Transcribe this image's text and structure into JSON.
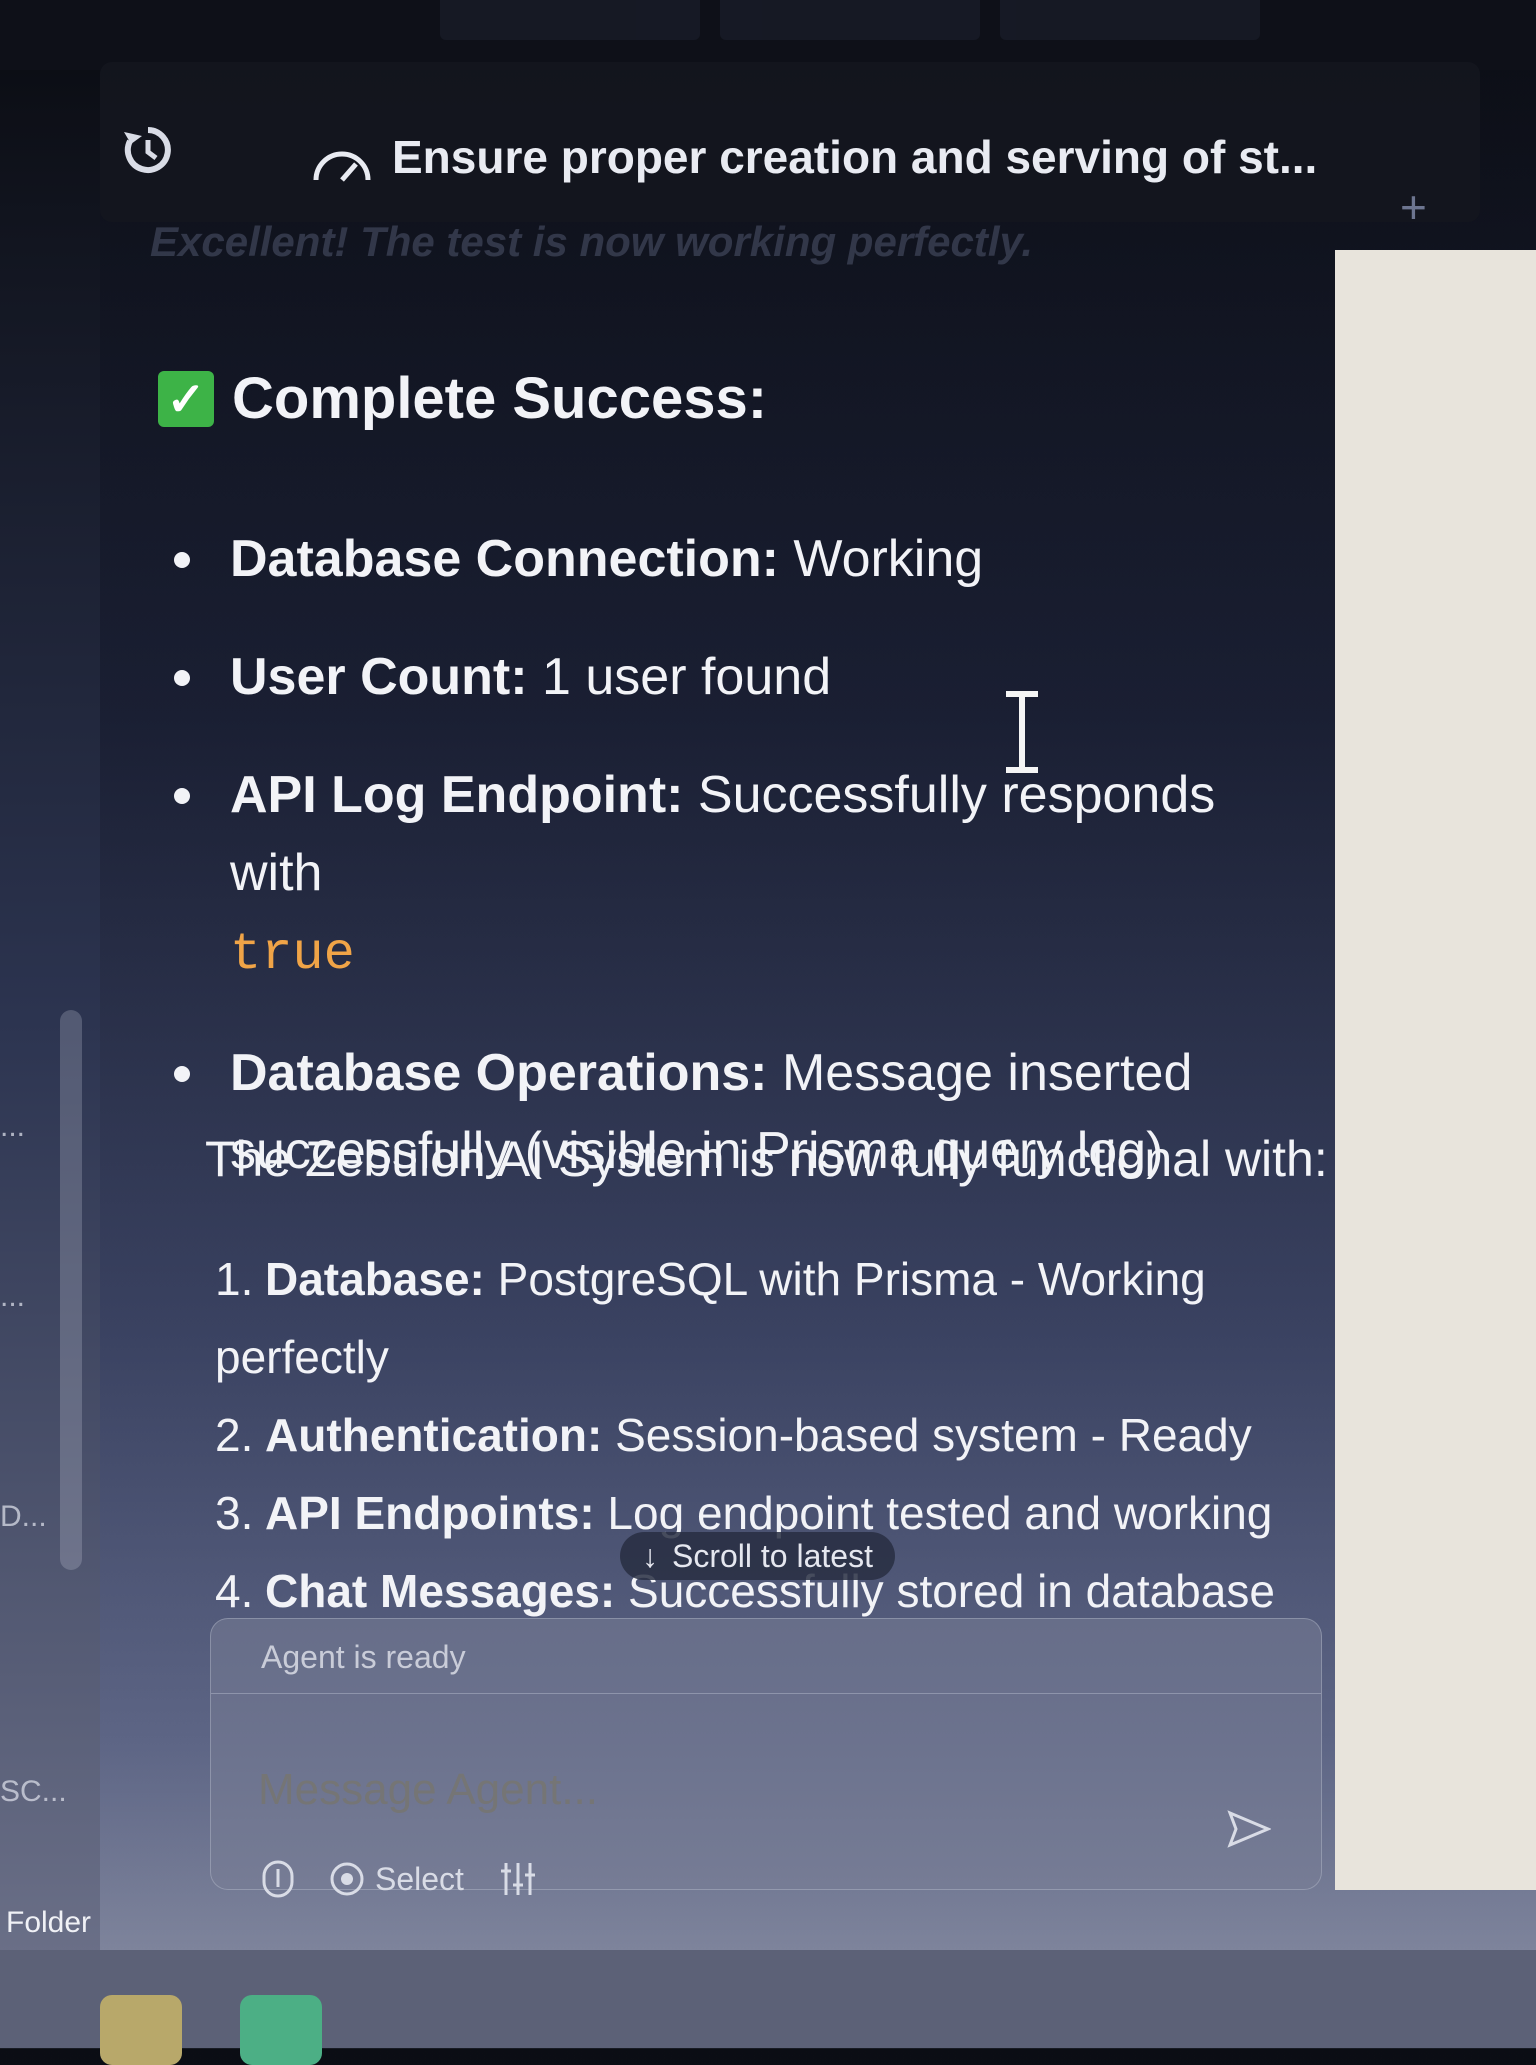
{
  "header": {
    "title": "Ensure proper creation and serving of st...",
    "ghost_text": "Excellent! The test is now working perfectly."
  },
  "left_rail": {
    "items": [
      "...",
      "...",
      "D...",
      "SC..."
    ],
    "folder_label": "Folder"
  },
  "message": {
    "heading": "Complete Success:",
    "bullets": [
      {
        "label": "Database Connection:",
        "text": " Working"
      },
      {
        "label": "User Count:",
        "text": " 1 user found"
      },
      {
        "label": "API Log Endpoint:",
        "text": " Successfully responds with ",
        "code": "true"
      },
      {
        "label": "Database Operations:",
        "text": " Message inserted successfully (visible in Prisma query log)"
      }
    ],
    "summary": "The Zebulon AI System is now fully functional with:",
    "numbered": [
      {
        "num": "1.",
        "label": "Database:",
        "text": " PostgreSQL with Prisma - Working perfectly"
      },
      {
        "num": "2.",
        "label": "Authentication:",
        "text": " Session-based system - Ready"
      },
      {
        "num": "3.",
        "label": "API Endpoints:",
        "text": " Log endpoint tested and working"
      },
      {
        "num": "4.",
        "label": "Chat Messages:",
        "text": " Successfully stored in database"
      }
    ]
  },
  "scroll_pill": {
    "arrow": "↓",
    "label": "Scroll to latest"
  },
  "composer": {
    "status": "Agent is ready",
    "placeholder": "Message Agent...",
    "select_label": "Select"
  },
  "colors": {
    "accent_code": "#f0a447",
    "check_green": "#3db347"
  }
}
